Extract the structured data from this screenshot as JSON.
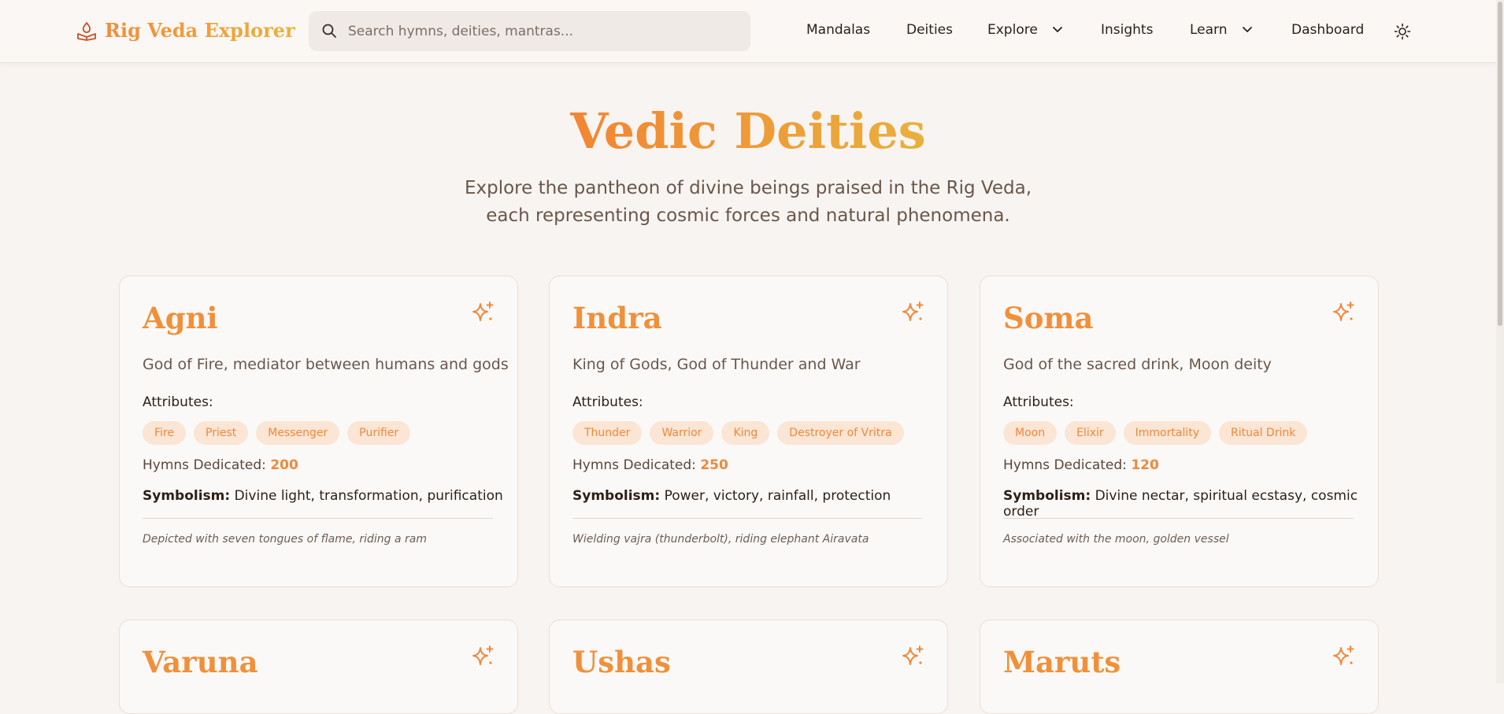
{
  "app": {
    "brand": "Rig Veda Explorer",
    "accent": "#f0903a",
    "accent2": "#e9b23e"
  },
  "search": {
    "placeholder": "Search hymns, deities, mantras...",
    "value": ""
  },
  "nav": {
    "mandalas": "Mandalas",
    "deities": "Deities",
    "explore": "Explore",
    "insights": "Insights",
    "learn": "Learn",
    "dashboard": "Dashboard"
  },
  "hero": {
    "title": "Vedic Deities",
    "subtitle": "Explore the pantheon of divine beings praised in the Rig Veda, each representing cosmic forces and natural phenomena."
  },
  "labels": {
    "attributes": "Attributes:",
    "hymns": "Hymns Dedicated: ",
    "symbolism": "Symbolism:"
  },
  "deities": [
    {
      "name": "Agni",
      "description": "God of Fire, mediator between humans and gods",
      "attributes": [
        "Fire",
        "Priest",
        "Messenger",
        "Purifier"
      ],
      "hymns": "200",
      "symbolism": "Divine light, transformation, purification",
      "depiction": "Depicted with seven tongues of flame, riding a ram"
    },
    {
      "name": "Indra",
      "description": "King of Gods, God of Thunder and War",
      "attributes": [
        "Thunder",
        "Warrior",
        "King",
        "Destroyer of Vritra"
      ],
      "hymns": "250",
      "symbolism": "Power, victory, rainfall, protection",
      "depiction": "Wielding vajra (thunderbolt), riding elephant Airavata"
    },
    {
      "name": "Soma",
      "description": "God of the sacred drink, Moon deity",
      "attributes": [
        "Moon",
        "Elixir",
        "Immortality",
        "Ritual Drink"
      ],
      "hymns": "120",
      "symbolism": "Divine nectar, spiritual ecstasy, cosmic order",
      "depiction": "Associated with the moon, golden vessel"
    },
    {
      "name": "Varuna"
    },
    {
      "name": "Ushas"
    },
    {
      "name": "Maruts"
    }
  ]
}
